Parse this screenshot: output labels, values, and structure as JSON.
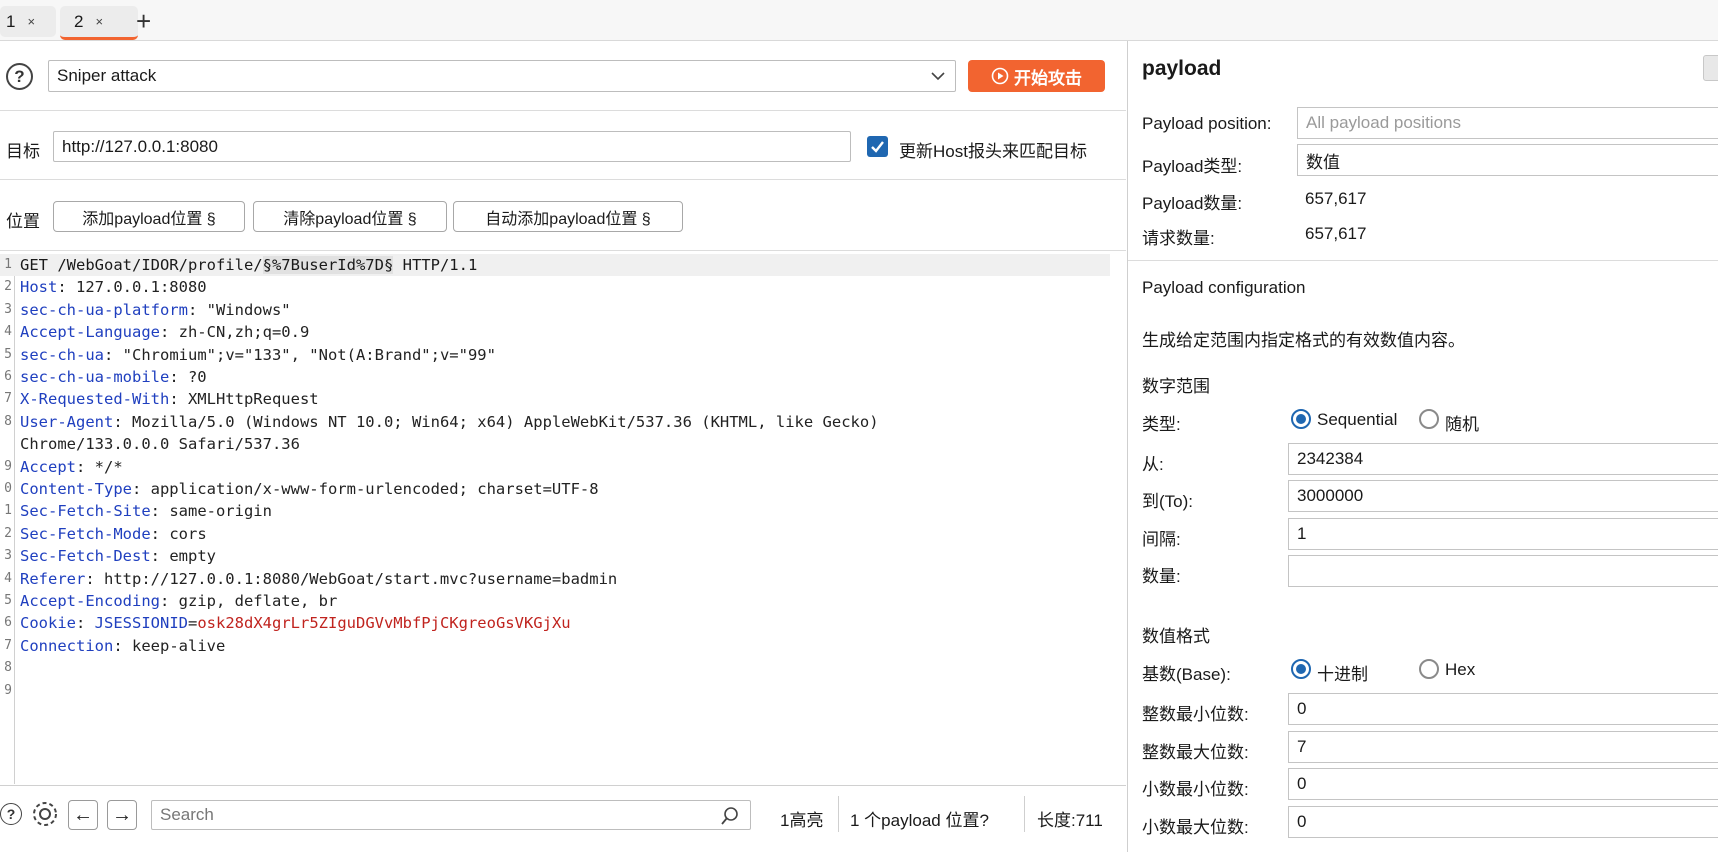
{
  "tabs": [
    {
      "label": "1",
      "close": "×"
    },
    {
      "label": "2",
      "close": "×"
    }
  ],
  "tab_add": "+",
  "attack": {
    "help": "?",
    "type_value": "Sniper attack",
    "start_label": "开始攻击"
  },
  "target": {
    "label": "目标",
    "url": "http://127.0.0.1:8080",
    "update_host_label": "更新Host报头来匹配目标",
    "update_host_checked": true
  },
  "positions": {
    "label": "位置",
    "add_label": "添加payload位置 §",
    "clear_label": "清除payload位置 §",
    "auto_label": "自动添加payload位置 §"
  },
  "request": {
    "line1_prefix": "GET /WebGoat/IDOR/profile/",
    "line1_marker": "§%7BuserId%7D§",
    "line1_suffix": " HTTP/1.1",
    "line_numbers": [
      "1",
      "2",
      "3",
      "4",
      "5",
      "6",
      "7",
      "8",
      "",
      "9",
      "0",
      "1",
      "2",
      "3",
      "4",
      "5",
      "6",
      "7",
      "8",
      "9"
    ],
    "headers": [
      {
        "k": "Host",
        "v": ": 127.0.0.1:8080"
      },
      {
        "k": "sec-ch-ua-platform",
        "v": ": \"Windows\""
      },
      {
        "k": "Accept-Language",
        "v": ": zh-CN,zh;q=0.9"
      },
      {
        "k": "sec-ch-ua",
        "v": ": \"Chromium\";v=\"133\", \"Not(A:Brand\";v=\"99\""
      },
      {
        "k": "sec-ch-ua-mobile",
        "v": ": ?0"
      },
      {
        "k": "X-Requested-With",
        "v": ": XMLHttpRequest"
      },
      {
        "k": "User-Agent",
        "v": ": Mozilla/5.0 (Windows NT 10.0; Win64; x64) AppleWebKit/537.36 (KHTML, like Gecko)"
      },
      {
        "k": "",
        "v": "Chrome/133.0.0.0 Safari/537.36"
      },
      {
        "k": "Accept",
        "v": ": */*"
      },
      {
        "k": "Content-Type",
        "v": ": application/x-www-form-urlencoded; charset=UTF-8"
      },
      {
        "k": "Sec-Fetch-Site",
        "v": ": same-origin"
      },
      {
        "k": "Sec-Fetch-Mode",
        "v": ": cors"
      },
      {
        "k": "Sec-Fetch-Dest",
        "v": ": empty"
      },
      {
        "k": "Referer",
        "v": ": http://127.0.0.1:8080/WebGoat/start.mvc?username=badmin"
      },
      {
        "k": "Accept-Encoding",
        "v": ": gzip, deflate, br"
      }
    ],
    "cookie_key": "Cookie",
    "cookie_name": "JSESSIONID",
    "cookie_value": "osk28dX4grLr5ZIguDGVvMbfPjCKgreoGsVKGjXu",
    "connection_key": "Connection",
    "connection_value": ": keep-alive"
  },
  "statusbar": {
    "search_placeholder": "Search",
    "highlights": "1高亮",
    "payload_positions": "1 个payload 位置?",
    "length": "长度:711"
  },
  "payload": {
    "title": "payload",
    "position_label": "Payload position:",
    "position_value": "All payload positions",
    "type_label": "Payload类型:",
    "type_value": "数值",
    "count_label": "Payload数量:",
    "count_value": "657,617",
    "request_count_label": "请求数量:",
    "request_count_value": "657,617",
    "config_title": "Payload configuration",
    "config_desc": "生成给定范围内指定格式的有效数值内容。",
    "range_section": "数字范围",
    "kind_label": "类型:",
    "kind_sequential": "Sequential",
    "kind_random": "随机",
    "from_label": "从:",
    "from_value": "2342384",
    "to_label": "到(To):",
    "to_value": "3000000",
    "step_label": "间隔:",
    "step_value": "1",
    "howmany_label": "数量:",
    "howmany_value": "",
    "format_section": "数值格式",
    "base_label": "基数(Base):",
    "base_decimal": "十进制",
    "base_hex": "Hex",
    "min_int_label": "整数最小位数:",
    "min_int_value": "0",
    "max_int_label": "整数最大位数:",
    "max_int_value": "7",
    "min_frac_label": "小数最小位数:",
    "min_frac_value": "0",
    "max_frac_label": "小数最大位数:",
    "max_frac_value": "0"
  },
  "colors": {
    "accent": "#f26430",
    "header_key": "#1f3fbf",
    "cookie_value": "#c0231e",
    "checkbox": "#1f67b1"
  }
}
